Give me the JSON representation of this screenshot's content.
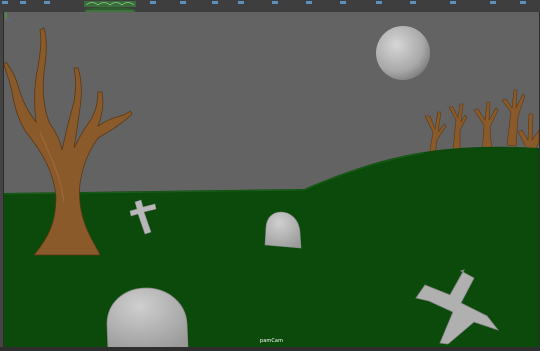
{
  "viewport": {
    "camera_label": "pamCam"
  },
  "icons": {
    "toolbar": [
      "toolbar-tool-icon",
      "toolbar-tool-icon",
      "toolbar-tool-icon",
      "toolbar-tool-icon",
      "toolbar-tool-icon"
    ],
    "axis": "axis-gizmo-icon"
  },
  "colors": {
    "sky": "#636363",
    "grass": "#0b4a0b",
    "moon": "#b5b5b5",
    "tree": "#8b5a2b",
    "stone": "#b3b3b3"
  }
}
